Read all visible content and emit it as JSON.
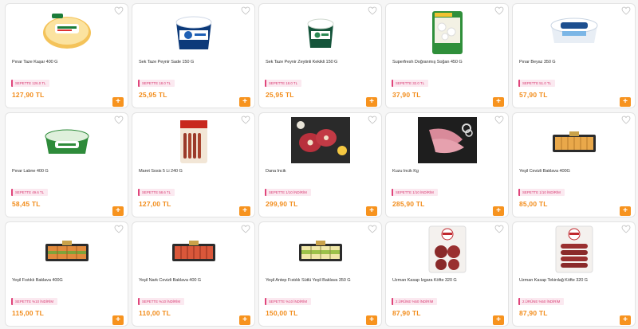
{
  "products": [
    {
      "name": "Pınar Taze Kaşar 400 G",
      "badge": "SEPETTE 126.0 TL",
      "price": "127,90 TL",
      "image_icon": "kasar-cheese-package-icon",
      "art": "cheese"
    },
    {
      "name": "Sek Taze Peynir Sade 150 G",
      "badge": "SEPETTE 18.0 TL",
      "price": "25,95 TL",
      "image_icon": "cream-cheese-tub-icon",
      "art": "tubblue"
    },
    {
      "name": "Sek Taze Peynir Zeytinli Kekikli 150 G",
      "badge": "SEPETTE 18.0 TL",
      "price": "25,95 TL",
      "image_icon": "herb-cheese-tub-icon",
      "art": "tubgreen"
    },
    {
      "name": "Superfresh Doğranmış Soğan 450 G",
      "badge": "SEPETTE 32.0 TL",
      "price": "37,90 TL",
      "image_icon": "frozen-onion-bag-icon",
      "art": "bag"
    },
    {
      "name": "Pınar Beyaz 350 G",
      "badge": "SEPETTE 51.0 TL",
      "price": "57,90 TL",
      "image_icon": "white-cheese-tub-icon",
      "art": "tubwhite"
    },
    {
      "name": "Pınar Labne 400 G",
      "badge": "SEPETTE 49.6 TL",
      "price": "58,45 TL",
      "image_icon": "labne-tub-icon",
      "art": "labne"
    },
    {
      "name": "Maret Sosis 5 Li 240 G",
      "badge": "SEPETTE 58.6 TL",
      "price": "127,00 TL",
      "image_icon": "sausage-pack-icon",
      "art": "sausage"
    },
    {
      "name": "Dana İncik",
      "badge": "SEPETTE 1/10 İNDİRİM",
      "price": "299,90 TL",
      "image_icon": "beef-shank-icon",
      "art": "meat"
    },
    {
      "name": "Kuzu İncik Kg",
      "badge": "SEPETTE 1/10 İNDİRİM",
      "price": "285,90 TL",
      "image_icon": "lamb-shank-icon",
      "art": "lamb"
    },
    {
      "name": "Yeşil Cevizli Baklava 400G",
      "badge": "SEPETTE 1/10 İNDİRİM",
      "price": "85,00 TL",
      "image_icon": "baklava-tray-icon",
      "art": "baklava1"
    },
    {
      "name": "Yeşil Fıstıklı Baklava 400G",
      "badge": "SEPETTE %10 İNDİRİM",
      "price": "115,00 TL",
      "image_icon": "pistachio-baklava-tray-icon",
      "art": "baklava2"
    },
    {
      "name": "Yeşil Nark Cevizli Baklava 400 G",
      "badge": "SEPETTE %10 İNDİRİM",
      "price": "110,00 TL",
      "image_icon": "walnut-baklava-tray-icon",
      "art": "baklava3"
    },
    {
      "name": "Yeşil Antep Fıstıklı Sütlü Yeşil Baklava 350 G",
      "badge": "SEPETTE %10 İNDİRİM",
      "price": "150,00 TL",
      "image_icon": "milk-baklava-tray-icon",
      "art": "baklava4"
    },
    {
      "name": "Uzman Kasap Izgara Köfte 320 G",
      "badge": "2.ÜRÜNE %50 İNDİRİM",
      "price": "87,90 TL",
      "image_icon": "grill-meatball-pack-icon",
      "art": "kofte1"
    },
    {
      "name": "Uzman Kasap Tekirdağ Köfte 320 G",
      "badge": "2.ÜRÜNE %50 İNDİRİM",
      "price": "87,90 TL",
      "image_icon": "tekirdag-meatball-pack-icon",
      "art": "kofte2"
    }
  ],
  "add_button_symbol": "+",
  "colors": {
    "price": "#f28c1a",
    "badge": "#d83a72",
    "button": "#f7931e"
  }
}
